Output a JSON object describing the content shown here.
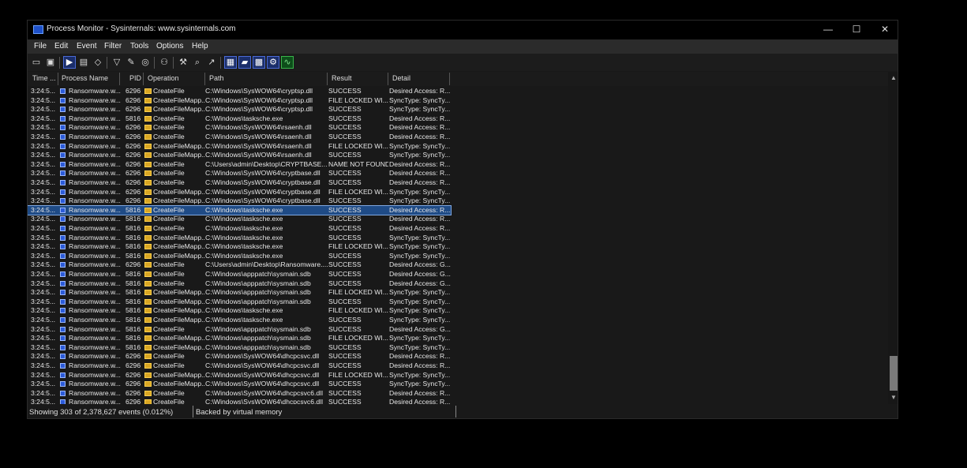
{
  "window": {
    "title": "Process Monitor - Sysinternals: www.sysinternals.com",
    "minimize": "—",
    "maximize": "☐",
    "close": "✕"
  },
  "menu": [
    "File",
    "Edit",
    "Event",
    "Filter",
    "Tools",
    "Options",
    "Help"
  ],
  "toolbar": {
    "icons": [
      "open-icon",
      "save-icon",
      "capture-icon",
      "autoscroll-icon",
      "clear-icon",
      "filter-icon",
      "highlight-icon",
      "include-process-icon",
      "process-tree-icon",
      "properties-icon",
      "find-icon",
      "jump-icon",
      "registry-icon",
      "filesystem-icon",
      "network-icon",
      "process-thread-icon",
      "profiling-icon"
    ]
  },
  "columns": [
    "Time ...",
    "Process Name",
    "PID",
    "Operation",
    "Path",
    "Result",
    "Detail"
  ],
  "rows": [
    [
      "3:24:5...",
      "Ransomware.w...",
      "6296",
      "CreateFile",
      "C:\\Windows\\SysWOW64\\cryptsp.dll",
      "SUCCESS",
      "Desired Access: R..."
    ],
    [
      "3:24:5...",
      "Ransomware.w...",
      "6296",
      "CreateFileMapp...",
      "C:\\Windows\\SysWOW64\\cryptsp.dll",
      "FILE LOCKED WI...",
      "SyncType: SyncTy..."
    ],
    [
      "3:24:5...",
      "Ransomware.w...",
      "6296",
      "CreateFileMapp...",
      "C:\\Windows\\SysWOW64\\cryptsp.dll",
      "SUCCESS",
      "SyncType: SyncTy..."
    ],
    [
      "3:24:5...",
      "Ransomware.w...",
      "5816",
      "CreateFile",
      "C:\\Windows\\tasksche.exe",
      "SUCCESS",
      "Desired Access: R..."
    ],
    [
      "3:24:5...",
      "Ransomware.w...",
      "6296",
      "CreateFile",
      "C:\\Windows\\SysWOW64\\rsaenh.dll",
      "SUCCESS",
      "Desired Access: R..."
    ],
    [
      "3:24:5...",
      "Ransomware.w...",
      "6296",
      "CreateFile",
      "C:\\Windows\\SysWOW64\\rsaenh.dll",
      "SUCCESS",
      "Desired Access: R..."
    ],
    [
      "3:24:5...",
      "Ransomware.w...",
      "6296",
      "CreateFileMapp...",
      "C:\\Windows\\SysWOW64\\rsaenh.dll",
      "FILE LOCKED WI...",
      "SyncType: SyncTy..."
    ],
    [
      "3:24:5...",
      "Ransomware.w...",
      "6296",
      "CreateFileMapp...",
      "C:\\Windows\\SysWOW64\\rsaenh.dll",
      "SUCCESS",
      "SyncType: SyncTy..."
    ],
    [
      "3:24:5...",
      "Ransomware.w...",
      "6296",
      "CreateFile",
      "C:\\Users\\admin\\Desktop\\CRYPTBASE....",
      "NAME NOT FOUND",
      "Desired Access: R..."
    ],
    [
      "3:24:5...",
      "Ransomware.w...",
      "6296",
      "CreateFile",
      "C:\\Windows\\SysWOW64\\cryptbase.dll",
      "SUCCESS",
      "Desired Access: R..."
    ],
    [
      "3:24:5...",
      "Ransomware.w...",
      "6296",
      "CreateFile",
      "C:\\Windows\\SysWOW64\\cryptbase.dll",
      "SUCCESS",
      "Desired Access: R..."
    ],
    [
      "3:24:5...",
      "Ransomware.w...",
      "6296",
      "CreateFileMapp...",
      "C:\\Windows\\SysWOW64\\cryptbase.dll",
      "FILE LOCKED WI...",
      "SyncType: SyncTy..."
    ],
    [
      "3:24:5...",
      "Ransomware.w...",
      "6296",
      "CreateFileMapp...",
      "C:\\Windows\\SysWOW64\\cryptbase.dll",
      "SUCCESS",
      "SyncType: SyncTy..."
    ],
    [
      "3:24:5...",
      "Ransomware.w...",
      "5816",
      "CreateFile",
      "C:\\Windows\\tasksche.exe",
      "SUCCESS",
      "Desired Access: R..."
    ],
    [
      "3:24:5...",
      "Ransomware.w...",
      "5816",
      "CreateFile",
      "C:\\Windows\\tasksche.exe",
      "SUCCESS",
      "Desired Access: R..."
    ],
    [
      "3:24:5...",
      "Ransomware.w...",
      "5816",
      "CreateFile",
      "C:\\Windows\\tasksche.exe",
      "SUCCESS",
      "Desired Access: R..."
    ],
    [
      "3:24:5...",
      "Ransomware.w...",
      "5816",
      "CreateFileMapp...",
      "C:\\Windows\\tasksche.exe",
      "SUCCESS",
      "SyncType: SyncTy..."
    ],
    [
      "3:24:5...",
      "Ransomware.w...",
      "5816",
      "CreateFileMapp...",
      "C:\\Windows\\tasksche.exe",
      "FILE LOCKED WI...",
      "SyncType: SyncTy..."
    ],
    [
      "3:24:5...",
      "Ransomware.w...",
      "5816",
      "CreateFileMapp...",
      "C:\\Windows\\tasksche.exe",
      "SUCCESS",
      "SyncType: SyncTy..."
    ],
    [
      "3:24:5...",
      "Ransomware.w...",
      "6296",
      "CreateFile",
      "C:\\Users\\admin\\Desktop\\Ransomware....",
      "SUCCESS",
      "Desired Access: G..."
    ],
    [
      "3:24:5...",
      "Ransomware.w...",
      "5816",
      "CreateFile",
      "C:\\Windows\\apppatch\\sysmain.sdb",
      "SUCCESS",
      "Desired Access: G..."
    ],
    [
      "3:24:5...",
      "Ransomware.w...",
      "5816",
      "CreateFile",
      "C:\\Windows\\apppatch\\sysmain.sdb",
      "SUCCESS",
      "Desired Access: G..."
    ],
    [
      "3:24:5...",
      "Ransomware.w...",
      "5816",
      "CreateFileMapp...",
      "C:\\Windows\\apppatch\\sysmain.sdb",
      "FILE LOCKED WI...",
      "SyncType: SyncTy..."
    ],
    [
      "3:24:5...",
      "Ransomware.w...",
      "5816",
      "CreateFileMapp...",
      "C:\\Windows\\apppatch\\sysmain.sdb",
      "SUCCESS",
      "SyncType: SyncTy..."
    ],
    [
      "3:24:5...",
      "Ransomware.w...",
      "5816",
      "CreateFileMapp...",
      "C:\\Windows\\tasksche.exe",
      "FILE LOCKED WI...",
      "SyncType: SyncTy..."
    ],
    [
      "3:24:5...",
      "Ransomware.w...",
      "5816",
      "CreateFileMapp...",
      "C:\\Windows\\tasksche.exe",
      "SUCCESS",
      "SyncType: SyncTy..."
    ],
    [
      "3:24:5...",
      "Ransomware.w...",
      "5816",
      "CreateFile",
      "C:\\Windows\\apppatch\\sysmain.sdb",
      "SUCCESS",
      "Desired Access: G..."
    ],
    [
      "3:24:5...",
      "Ransomware.w...",
      "5816",
      "CreateFileMapp...",
      "C:\\Windows\\apppatch\\sysmain.sdb",
      "FILE LOCKED WI...",
      "SyncType: SyncTy..."
    ],
    [
      "3:24:5...",
      "Ransomware.w...",
      "5816",
      "CreateFileMapp...",
      "C:\\Windows\\apppatch\\sysmain.sdb",
      "SUCCESS",
      "SyncType: SyncTy..."
    ],
    [
      "3:24:5...",
      "Ransomware.w...",
      "6296",
      "CreateFile",
      "C:\\Windows\\SysWOW64\\dhcpcsvc.dll",
      "SUCCESS",
      "Desired Access: R..."
    ],
    [
      "3:24:5...",
      "Ransomware.w...",
      "6296",
      "CreateFile",
      "C:\\Windows\\SysWOW64\\dhcpcsvc.dll",
      "SUCCESS",
      "Desired Access: R..."
    ],
    [
      "3:24:5...",
      "Ransomware.w...",
      "6296",
      "CreateFileMapp...",
      "C:\\Windows\\SysWOW64\\dhcpcsvc.dll",
      "FILE LOCKED WI...",
      "SyncType: SyncTy..."
    ],
    [
      "3:24:5...",
      "Ransomware.w...",
      "6296",
      "CreateFileMapp...",
      "C:\\Windows\\SysWOW64\\dhcpcsvc.dll",
      "SUCCESS",
      "SyncType: SyncTy..."
    ],
    [
      "3:24:5...",
      "Ransomware.w...",
      "6296",
      "CreateFile",
      "C:\\Windows\\SysWOW64\\dhcpcsvc6.dll",
      "SUCCESS",
      "Desired Access: R..."
    ],
    [
      "3:24:5...",
      "Ransomware.w...",
      "6296",
      "CreateFile",
      "C:\\Windows\\SysWOW64\\dhcpcsvc6.dll",
      "SUCCESS",
      "Desired Access: R..."
    ]
  ],
  "selected_row": 13,
  "status": {
    "events": "Showing 303 of 2,378,627 events (0.012%)",
    "memory": "Backed by virtual memory"
  }
}
